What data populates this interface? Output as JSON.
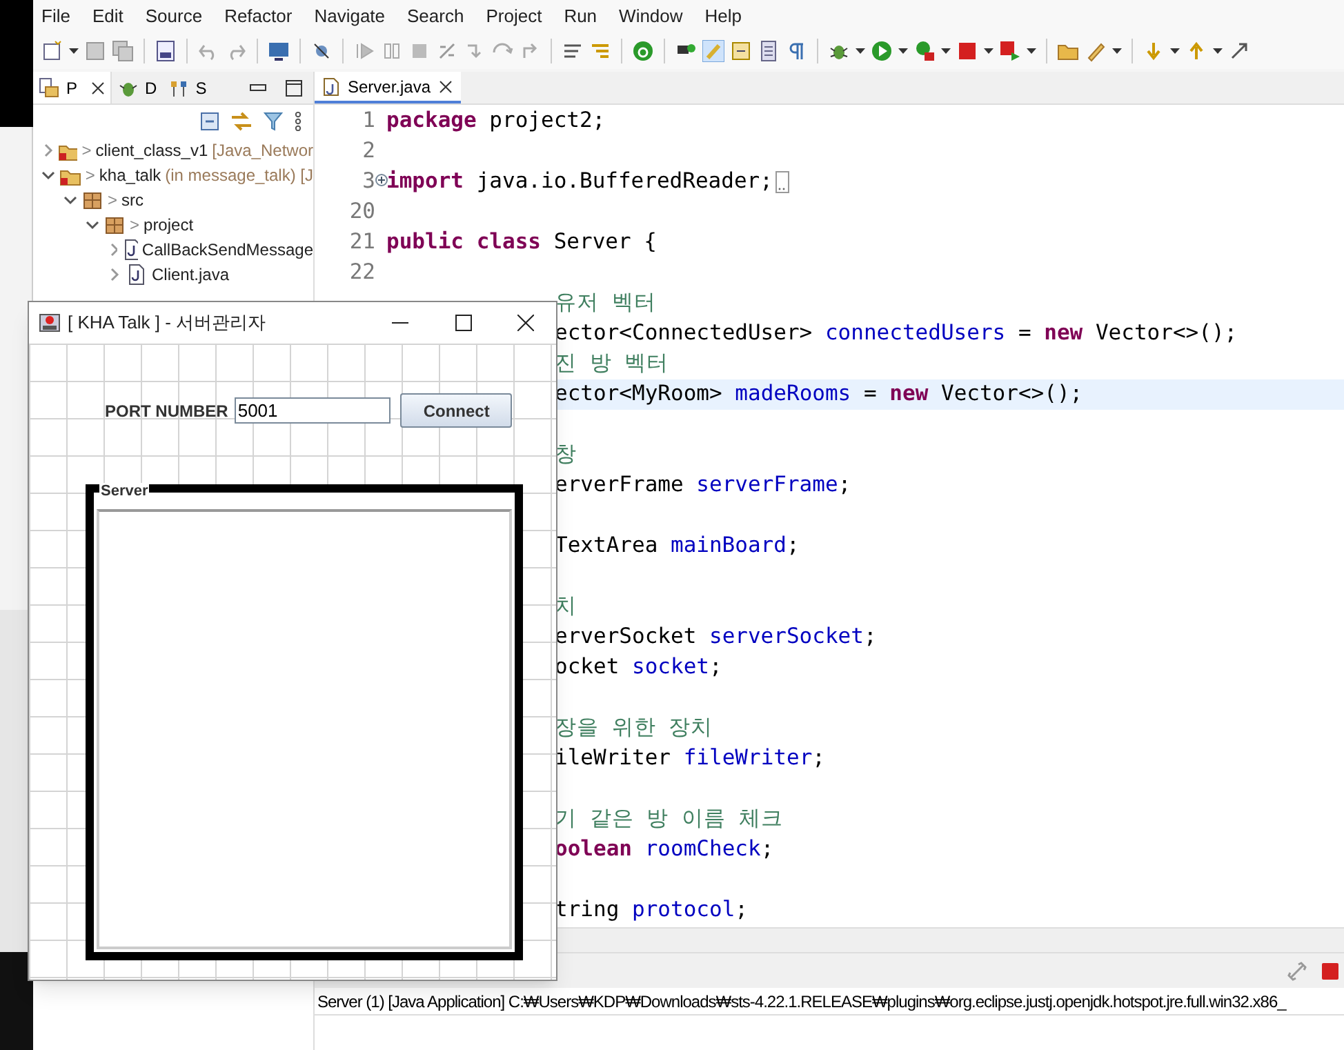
{
  "menu": [
    "File",
    "Edit",
    "Source",
    "Refactor",
    "Navigate",
    "Search",
    "Project",
    "Run",
    "Window",
    "Help"
  ],
  "explorer": {
    "tabs": [
      {
        "label": "P",
        "selected": true
      },
      {
        "label": "D",
        "selected": false
      },
      {
        "label": "S",
        "selected": false
      }
    ],
    "tree": [
      {
        "prefix": ">",
        "label": "client_class_v1",
        "decoration": "[Java_Networ",
        "expanded": false
      },
      {
        "prefix": ">",
        "label": "kha_talk",
        "decoration": "(in message_talk) [J",
        "expanded": true,
        "children": [
          {
            "prefix": ">",
            "label": "src",
            "expanded": true,
            "children": [
              {
                "prefix": ">",
                "label": "project",
                "expanded": true,
                "children": [
                  {
                    "label": "CallBackSendMessage",
                    "expanded": false
                  },
                  {
                    "label": "Client.java",
                    "expanded": false
                  }
                ]
              }
            ]
          }
        ]
      }
    ]
  },
  "editor": {
    "tab": "Server.java",
    "lines": [
      {
        "number": "1",
        "kind": "full",
        "current": false,
        "tokens": [
          {
            "kind": "keyword",
            "s": "package"
          },
          {
            "kind": "plain",
            "s": "project2;",
            "gap": true
          }
        ]
      },
      {
        "number": "2",
        "kind": "full",
        "current": false
      },
      {
        "number": "3",
        "kind": "full",
        "current": false,
        "folded": true,
        "tokens": [
          {
            "kind": "keyword",
            "s": "import"
          },
          {
            "kind": "plain",
            "s": "java.io.BufferedReader;",
            "gap": true
          }
        ]
      },
      {
        "number": "20",
        "kind": "full",
        "current": false
      },
      {
        "number": "21",
        "kind": "full",
        "current": false,
        "tokens": [
          {
            "kind": "keyword",
            "s": "public"
          },
          {
            "kind": "keyword",
            "s": "class",
            "gap": true
          },
          {
            "kind": "plain",
            "s": "Server {",
            "gap": true
          }
        ]
      },
      {
        "number": "22",
        "kind": "full",
        "current": false
      },
      {
        "kind": "partial",
        "current": false,
        "tokens": [
          {
            "kind": "comment",
            "s": "유저 벡터"
          }
        ]
      },
      {
        "kind": "partial",
        "current": false,
        "tokens": [
          {
            "kind": "plain",
            "s": "ector<ConnectedUser>"
          },
          {
            "kind": "field",
            "s": "connectedUsers",
            "gap": true
          },
          {
            "kind": "plain",
            "s": "=",
            "gap": true
          },
          {
            "kind": "keyword",
            "s": "new",
            "gap": true
          },
          {
            "kind": "plain",
            "s": "Vector<>();",
            "gap": true
          }
        ]
      },
      {
        "kind": "partial",
        "current": false,
        "tokens": [
          {
            "kind": "comment",
            "s": "진 방 벡터"
          }
        ]
      },
      {
        "kind": "partial",
        "current": true,
        "tokens": [
          {
            "kind": "plain",
            "s": "ector<MyRoom>"
          },
          {
            "kind": "field",
            "s": "madeRooms",
            "gap": true
          },
          {
            "kind": "plain",
            "s": "=",
            "gap": true
          },
          {
            "kind": "keyword",
            "s": "new",
            "gap": true
          },
          {
            "kind": "plain",
            "s": "Vector<>();",
            "gap": true
          }
        ]
      },
      {
        "kind": "partial",
        "current": false
      },
      {
        "kind": "partial",
        "current": false,
        "tokens": [
          {
            "kind": "comment",
            "s": "창"
          }
        ]
      },
      {
        "kind": "partial",
        "current": false,
        "tokens": [
          {
            "kind": "plain",
            "s": "erverFrame"
          },
          {
            "kind": "field",
            "s": "serverFrame",
            "gap": true
          },
          {
            "kind": "plain",
            "s": ";"
          }
        ]
      },
      {
        "kind": "partial",
        "current": false
      },
      {
        "kind": "partial",
        "current": false,
        "tokens": [
          {
            "kind": "plain",
            "s": "TextArea"
          },
          {
            "kind": "field",
            "s": "mainBoard",
            "gap": true
          },
          {
            "kind": "plain",
            "s": ";"
          }
        ]
      },
      {
        "kind": "partial",
        "current": false
      },
      {
        "kind": "partial",
        "current": false,
        "tokens": [
          {
            "kind": "comment",
            "s": "치"
          }
        ]
      },
      {
        "kind": "partial",
        "current": false,
        "tokens": [
          {
            "kind": "plain",
            "s": "erverSocket"
          },
          {
            "kind": "field",
            "s": "serverSocket",
            "gap": true
          },
          {
            "kind": "plain",
            "s": ";"
          }
        ]
      },
      {
        "kind": "partial",
        "current": false,
        "tokens": [
          {
            "kind": "plain",
            "s": "ocket"
          },
          {
            "kind": "field",
            "s": "socket",
            "gap": true
          },
          {
            "kind": "plain",
            "s": ";"
          }
        ]
      },
      {
        "kind": "partial",
        "current": false
      },
      {
        "kind": "partial",
        "current": false,
        "tokens": [
          {
            "kind": "comment",
            "s": "장을 위한 장치"
          }
        ]
      },
      {
        "kind": "partial",
        "current": false,
        "tokens": [
          {
            "kind": "plain",
            "s": "ileWriter"
          },
          {
            "kind": "field",
            "s": "fileWriter",
            "gap": true
          },
          {
            "kind": "plain",
            "s": ";"
          }
        ]
      },
      {
        "kind": "partial",
        "current": false
      },
      {
        "kind": "partial",
        "current": false,
        "tokens": [
          {
            "kind": "comment",
            "s": "기 같은 방 이름 체크"
          }
        ]
      },
      {
        "kind": "partial",
        "current": false,
        "tokens": [
          {
            "kind": "keyword",
            "s": "oolean"
          },
          {
            "kind": "field",
            "s": "roomCheck",
            "gap": true
          },
          {
            "kind": "plain",
            "s": ";"
          }
        ]
      },
      {
        "kind": "partial",
        "current": false
      },
      {
        "kind": "partial",
        "current": false,
        "tokens": [
          {
            "kind": "plain",
            "s": "tring"
          },
          {
            "kind": "field",
            "s": "protocol",
            "gap": true
          },
          {
            "kind": "plain",
            "s": ";"
          }
        ]
      }
    ]
  },
  "console": {
    "process": "Server (1) [Java Application] C:₩Users₩KDP₩Downloads₩sts-4.22.1.RELEASE₩plugins₩org.eclipse.justj.openjdk.hotspot.jre.full.win32.x86_"
  },
  "dialog": {
    "title": "[ KHA Talk ] - 서버관리자",
    "port_label": "PORT NUMBER",
    "port_value": "5001",
    "connect": "Connect",
    "group_title": "Server"
  }
}
